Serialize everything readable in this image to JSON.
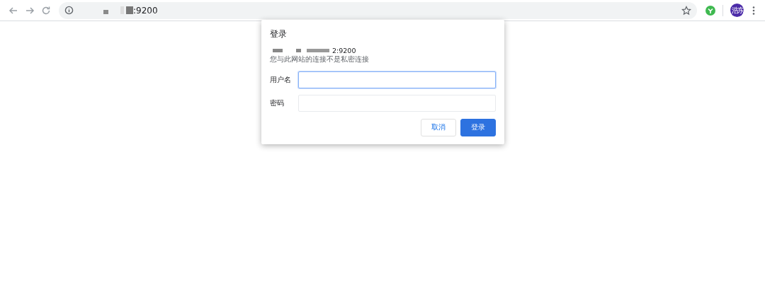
{
  "address_bar": {
    "url": ":9200"
  },
  "profile": {
    "avatar_text": "浩东"
  },
  "dialog": {
    "title": "登录",
    "host": "2:9200",
    "warning": "您与此网站的连接不是私密连接",
    "fields": [
      {
        "label": "用户名",
        "focused": true
      },
      {
        "label": "密码",
        "focused": false
      }
    ],
    "buttons": [
      {
        "label": "取消",
        "kind": "secondary"
      },
      {
        "label": "登录",
        "kind": "primary"
      }
    ]
  }
}
